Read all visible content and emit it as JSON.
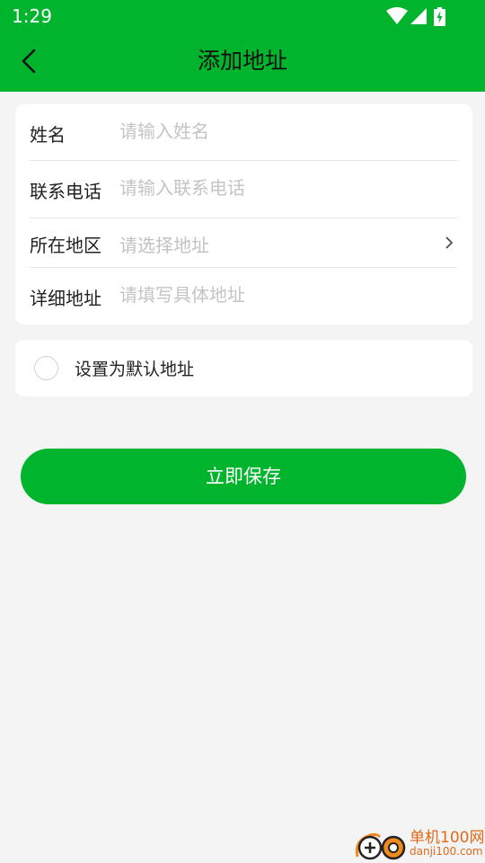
{
  "status_bar": {
    "time": "1:29",
    "icons": [
      "wifi-icon",
      "cellular-signal-icon",
      "battery-charging-icon"
    ]
  },
  "header": {
    "title": "添加地址",
    "back_icon": "chevron-left-icon",
    "background": "#00b52d"
  },
  "form": {
    "name": {
      "label": "姓名",
      "placeholder": "请输入姓名",
      "value": ""
    },
    "phone": {
      "label": "联系电话",
      "placeholder": "请输入联系电话",
      "value": ""
    },
    "region": {
      "label": "所在地区",
      "placeholder": "请选择地址",
      "icon": "chevron-right-icon"
    },
    "detail": {
      "label": "详细地址",
      "placeholder": "请填写具体地址",
      "value": ""
    }
  },
  "default_option": {
    "label": "设置为默认地址",
    "checked": false
  },
  "save_button": {
    "label": "立即保存",
    "color": "#00b52d"
  },
  "watermark": {
    "line1": "单机100网",
    "line2": "danji100.com"
  }
}
